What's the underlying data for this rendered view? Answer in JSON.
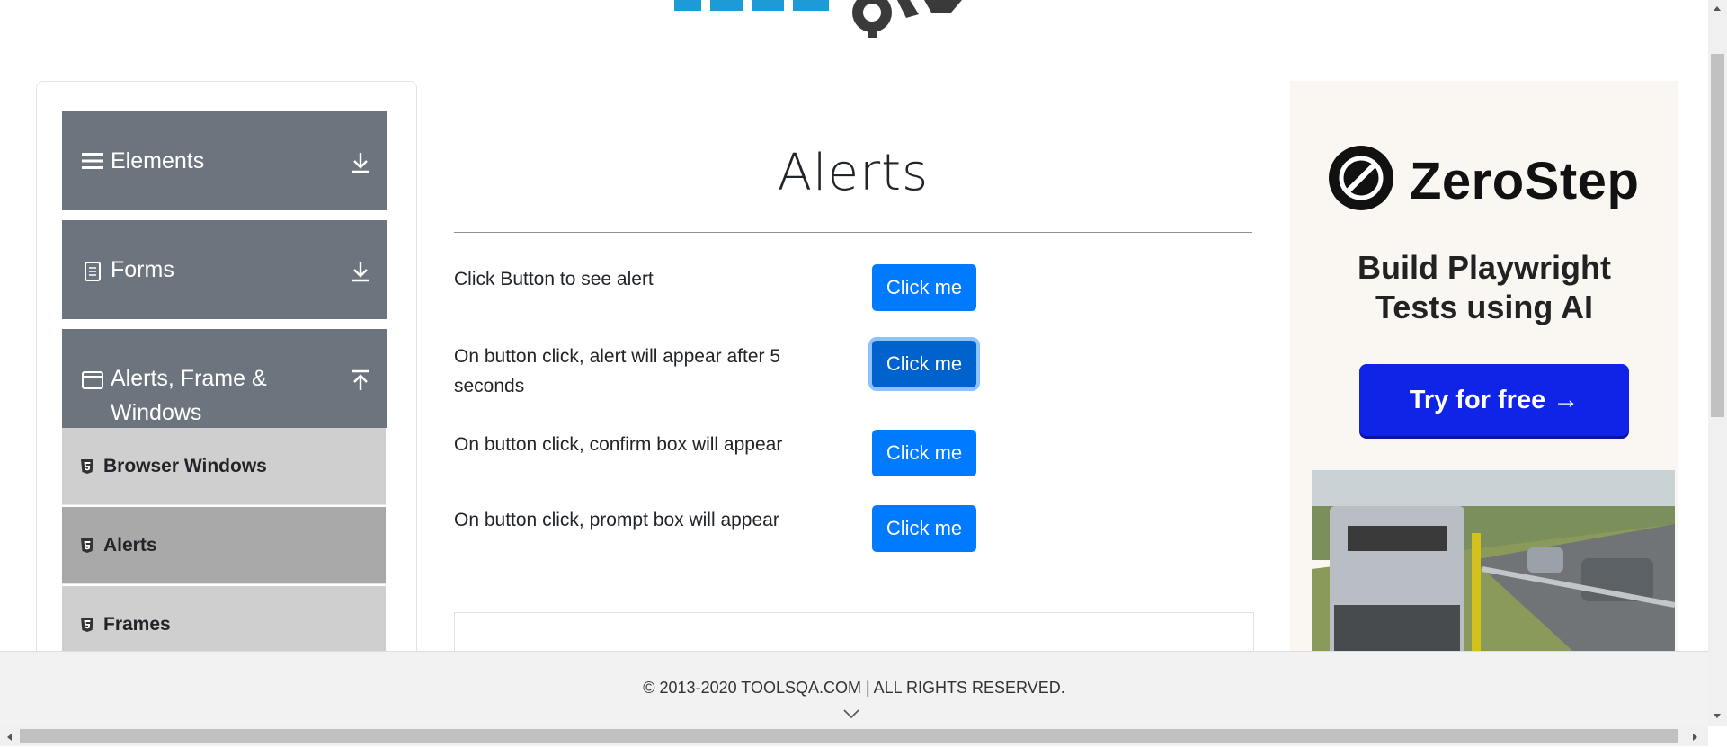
{
  "sidebar": {
    "groups": [
      {
        "title": "Elements",
        "icon": "hamburger-icon",
        "toggle": "download-icon"
      },
      {
        "title": "Forms",
        "icon": "document-icon",
        "toggle": "download-icon"
      },
      {
        "title": "Alerts, Frame &",
        "title_line2": "Windows",
        "icon": "window-icon",
        "toggle": "upload-icon"
      }
    ],
    "items": [
      {
        "label": "Browser Windows",
        "icon": "html5-icon"
      },
      {
        "label": "Alerts",
        "icon": "html5-icon",
        "active": true
      },
      {
        "label": "Frames",
        "icon": "html5-icon"
      }
    ]
  },
  "main": {
    "title": "Alerts",
    "rows": [
      {
        "text": "Click Button to see alert",
        "button": "Click me"
      },
      {
        "text": "On button click, alert will appear after 5 seconds",
        "button": "Click me"
      },
      {
        "text": "On button click, confirm box will appear",
        "button": "Click me"
      },
      {
        "text": "On button click, prompt box will appear",
        "button": "Click me"
      }
    ]
  },
  "ad": {
    "brand": "ZeroStep",
    "headline_line1": "Build Playwright",
    "headline_line2": "Tests using AI",
    "cta": "Try for free →"
  },
  "footer": {
    "text": "© 2013-2020 TOOLSQA.COM | ALL RIGHTS RESERVED."
  },
  "colors": {
    "primary": "#007bff",
    "sidebar_header": "#6c757d",
    "menu_item": "#cfcfcf",
    "menu_item_active": "#a9a9a9",
    "ad_cta": "#1024e8"
  }
}
